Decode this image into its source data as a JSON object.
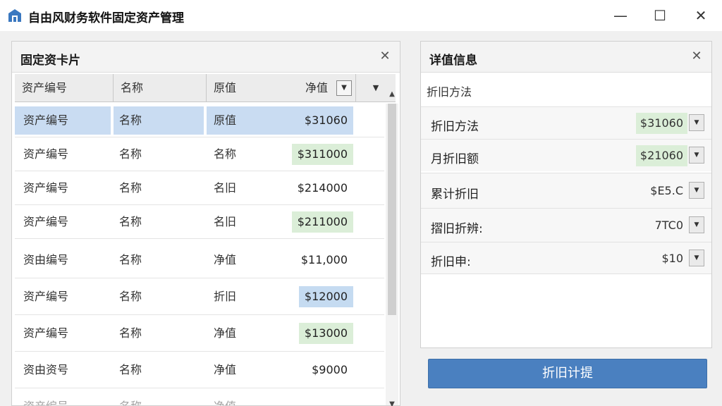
{
  "window": {
    "title": "自由风财务软件固定资产管理",
    "app_icon": "house-icon",
    "controls": {
      "minimize": "—",
      "maximize": "☐",
      "close": "✕"
    }
  },
  "left_panel": {
    "title": "固定资卡片",
    "close": "✕",
    "columns": [
      "资产编号",
      "名称",
      "原值",
      "净值"
    ],
    "sort_arrow": "▼",
    "more_arrow": "▼",
    "rows": [
      {
        "c0": "资产编号",
        "c1": "名称",
        "c2": "原值",
        "value": "$31060",
        "style": "selected"
      },
      {
        "c0": "资产编号",
        "c1": "名称",
        "c2": "名称",
        "value": "$311000",
        "style": "green"
      },
      {
        "c0": "资产编号",
        "c1": "名称",
        "c2": "名旧",
        "value": "$214000",
        "style": "plain"
      },
      {
        "c0": "资产编号",
        "c1": "名称",
        "c2": "名旧",
        "value": "$211000",
        "style": "green"
      },
      {
        "c0": "资由编号",
        "c1": "名称",
        "c2": "净值",
        "value": "$11,000",
        "style": "plain"
      },
      {
        "c0": "资产编号",
        "c1": "名称",
        "c2": "折旧",
        "value": "$12000",
        "style": "blue"
      },
      {
        "c0": "资产编号",
        "c1": "名称",
        "c2": "净值",
        "value": "$13000",
        "style": "green"
      },
      {
        "c0": "资由资号",
        "c1": "名称",
        "c2": "净值",
        "value": "$9000",
        "style": "plain"
      },
      {
        "c0": "资产编号",
        "c1": "名称",
        "c2": "净值",
        "value": "",
        "style": "plain"
      }
    ],
    "scroll_up": "▲",
    "scroll_down": "▼"
  },
  "right_panel": {
    "title": "详值信息",
    "close": "✕",
    "subtitle": "折旧方法",
    "fields": [
      {
        "label": "折旧方法",
        "value": "$31060",
        "style": "green"
      },
      {
        "label": "月折旧额",
        "value": "$21060",
        "style": "green"
      },
      {
        "label": "累计折旧",
        "value": "$E5.C",
        "style": "plain"
      },
      {
        "label": "摺旧折辨:",
        "value": "7TC0",
        "style": "plain"
      },
      {
        "label": "折旧申:",
        "value": "$10",
        "style": "plain"
      }
    ],
    "dropdown_arrow": "▼"
  },
  "action": {
    "label": "折旧计提"
  },
  "colors": {
    "accent": "#4a80c0",
    "selected_row": "#c9dcf2",
    "green_badge": "#dbeed8"
  }
}
